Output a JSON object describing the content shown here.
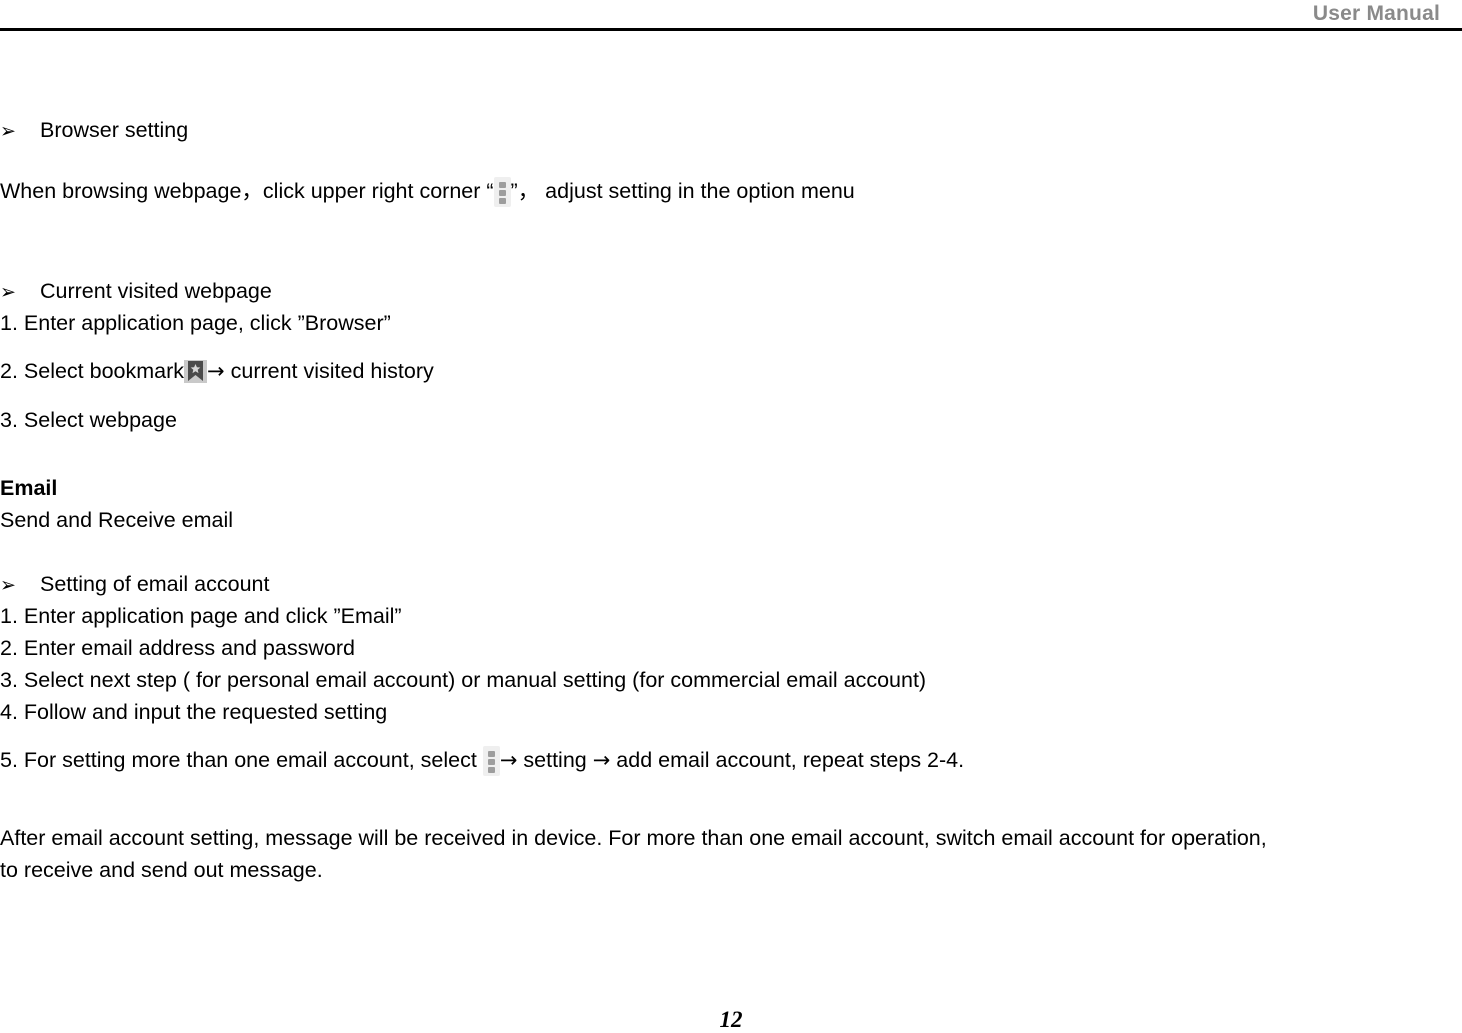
{
  "header": {
    "title": "User Manual",
    "rule_color": "#000000",
    "title_color": "#8a8a8a"
  },
  "icons": {
    "overflow_menu": "three-dots-vertical-icon",
    "bookmark": "bookmark-star-icon",
    "bullet": "➢",
    "arrow_right": "→",
    "dot_color": "#9d9d9d",
    "dot_bg_color": "#efefef",
    "bookmark_bg_color": "#c9c9c9",
    "bookmark_fill_color": "#4a4a4a"
  },
  "sections": {
    "browser_setting": {
      "bullet_label": "Browser setting",
      "sentence_before_icon": "When browsing webpage，click upper right corner “",
      "sentence_after_icon": "”， adjust setting in the option menu"
    },
    "current_visited_webpage": {
      "bullet_label": "Current visited webpage",
      "step1": "1. Enter application page, click ”Browser”",
      "step2_before_icon": "2. Select bookmark",
      "step2_after_icon": " current visited history",
      "step3": "3. Select webpage"
    },
    "email": {
      "heading": "Email",
      "subtitle": "Send and Receive email",
      "account_setting": {
        "bullet_label": "Setting of email account",
        "step1": "1. Enter application page and click ”Email”",
        "step2": "2. Enter email address and password",
        "step3": "3. Select next step ( for personal email account) or manual setting (for commercial email account)",
        "step4": "4. Follow and input the requested setting",
        "step5_before_icon": "5. For setting more than one email account, select ",
        "step5_after_icon_1": " setting ",
        "step5_after_icon_2": " add email account, repeat steps 2-4."
      },
      "closing_paragraph_line1": "After email account setting, message will be received in device. For more than one email account, switch email account for operation,",
      "closing_paragraph_line2": "to receive and send out message."
    }
  },
  "footer": {
    "page_number": "12"
  }
}
